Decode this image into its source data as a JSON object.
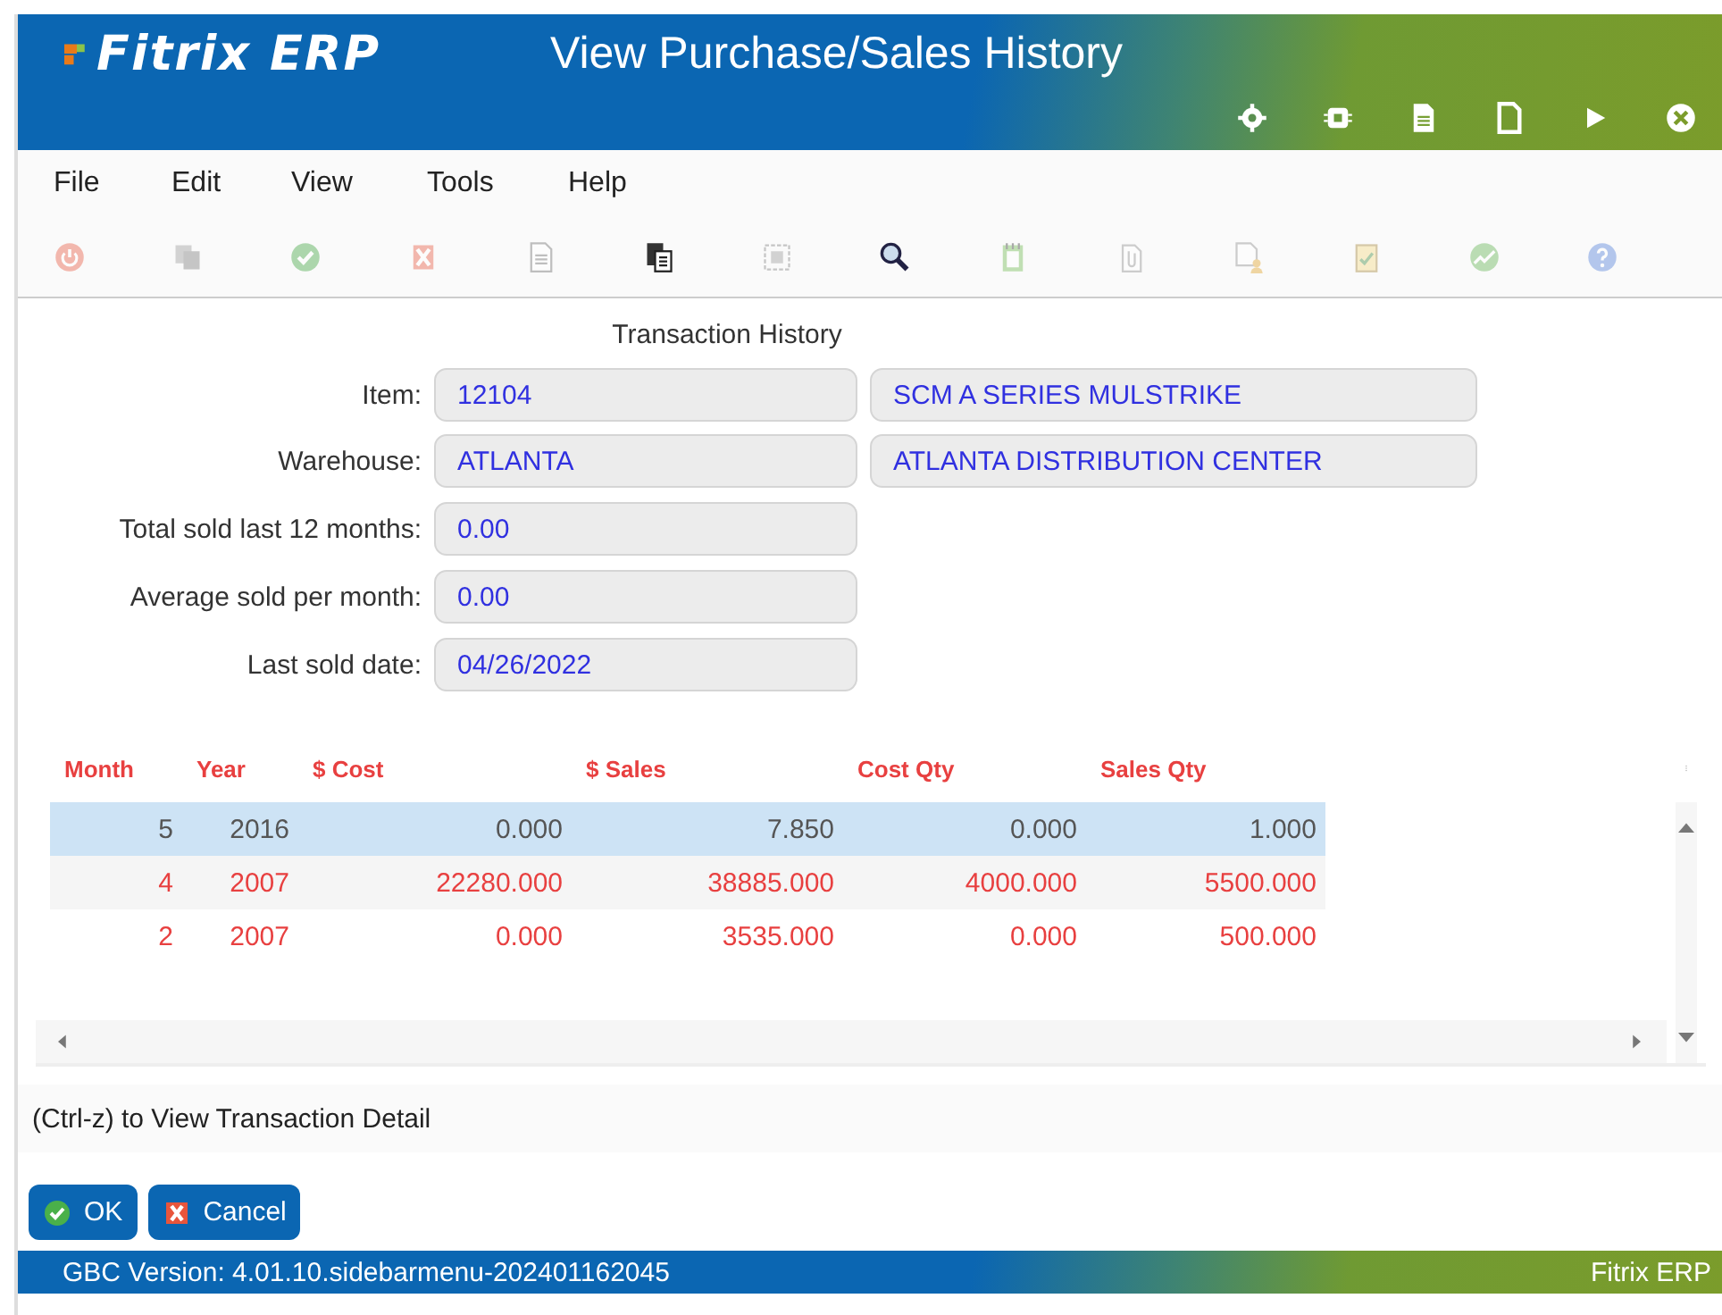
{
  "header": {
    "logo": "Fitrix ERP",
    "title": "View Purchase/Sales History"
  },
  "menu": [
    "File",
    "Edit",
    "View",
    "Tools",
    "Help"
  ],
  "toolbar": [
    {
      "kind": "power",
      "disabled": true
    },
    {
      "kind": "copy",
      "disabled": true
    },
    {
      "kind": "check",
      "disabled": true
    },
    {
      "kind": "cancel",
      "disabled": true
    },
    {
      "kind": "doc",
      "disabled": true
    },
    {
      "kind": "paste",
      "disabled": false
    },
    {
      "kind": "select",
      "disabled": true
    },
    {
      "kind": "zoom",
      "disabled": false
    },
    {
      "kind": "notepad",
      "disabled": true
    },
    {
      "kind": "attach",
      "disabled": true
    },
    {
      "kind": "docuser",
      "disabled": true
    },
    {
      "kind": "checklist",
      "disabled": true
    },
    {
      "kind": "chart",
      "disabled": true
    },
    {
      "kind": "help",
      "disabled": true
    }
  ],
  "form": {
    "title": "Transaction History",
    "fields": [
      {
        "label": "Item:",
        "value": "12104",
        "description": "SCM A SERIES MULSTRIKE"
      },
      {
        "label": "Warehouse:",
        "value": "ATLANTA",
        "description": "ATLANTA DISTRIBUTION CENTER"
      },
      {
        "label": "Total sold last 12 months:",
        "value": "0.00"
      },
      {
        "label": "Average sold per month:",
        "value": "0.00"
      },
      {
        "label": "Last sold date:",
        "value": "04/26/2022"
      }
    ]
  },
  "table": {
    "columns": [
      "Month",
      "Year",
      "$ Cost",
      "$ Sales",
      "Cost Qty",
      "Sales Qty"
    ],
    "rows": [
      {
        "selected": true,
        "cells": [
          "5",
          "2016",
          "0.000",
          "7.850",
          "0.000",
          "1.000"
        ]
      },
      {
        "selected": false,
        "cells": [
          "4",
          "2007",
          "22280.000",
          "38885.000",
          "4000.000",
          "5500.000"
        ]
      },
      {
        "selected": false,
        "cells": [
          "2",
          "2007",
          "0.000",
          "3535.000",
          "0.000",
          "500.000"
        ]
      }
    ]
  },
  "hint": "(Ctrl-z) to View Transaction Detail",
  "buttons": [
    {
      "kind": "ok",
      "label": "OK"
    },
    {
      "kind": "cancel",
      "label": "Cancel"
    }
  ],
  "status_bar": {
    "version": "GBC Version: 4.01.10.sidebarmenu-202401162045",
    "app": "Fitrix ERP"
  }
}
